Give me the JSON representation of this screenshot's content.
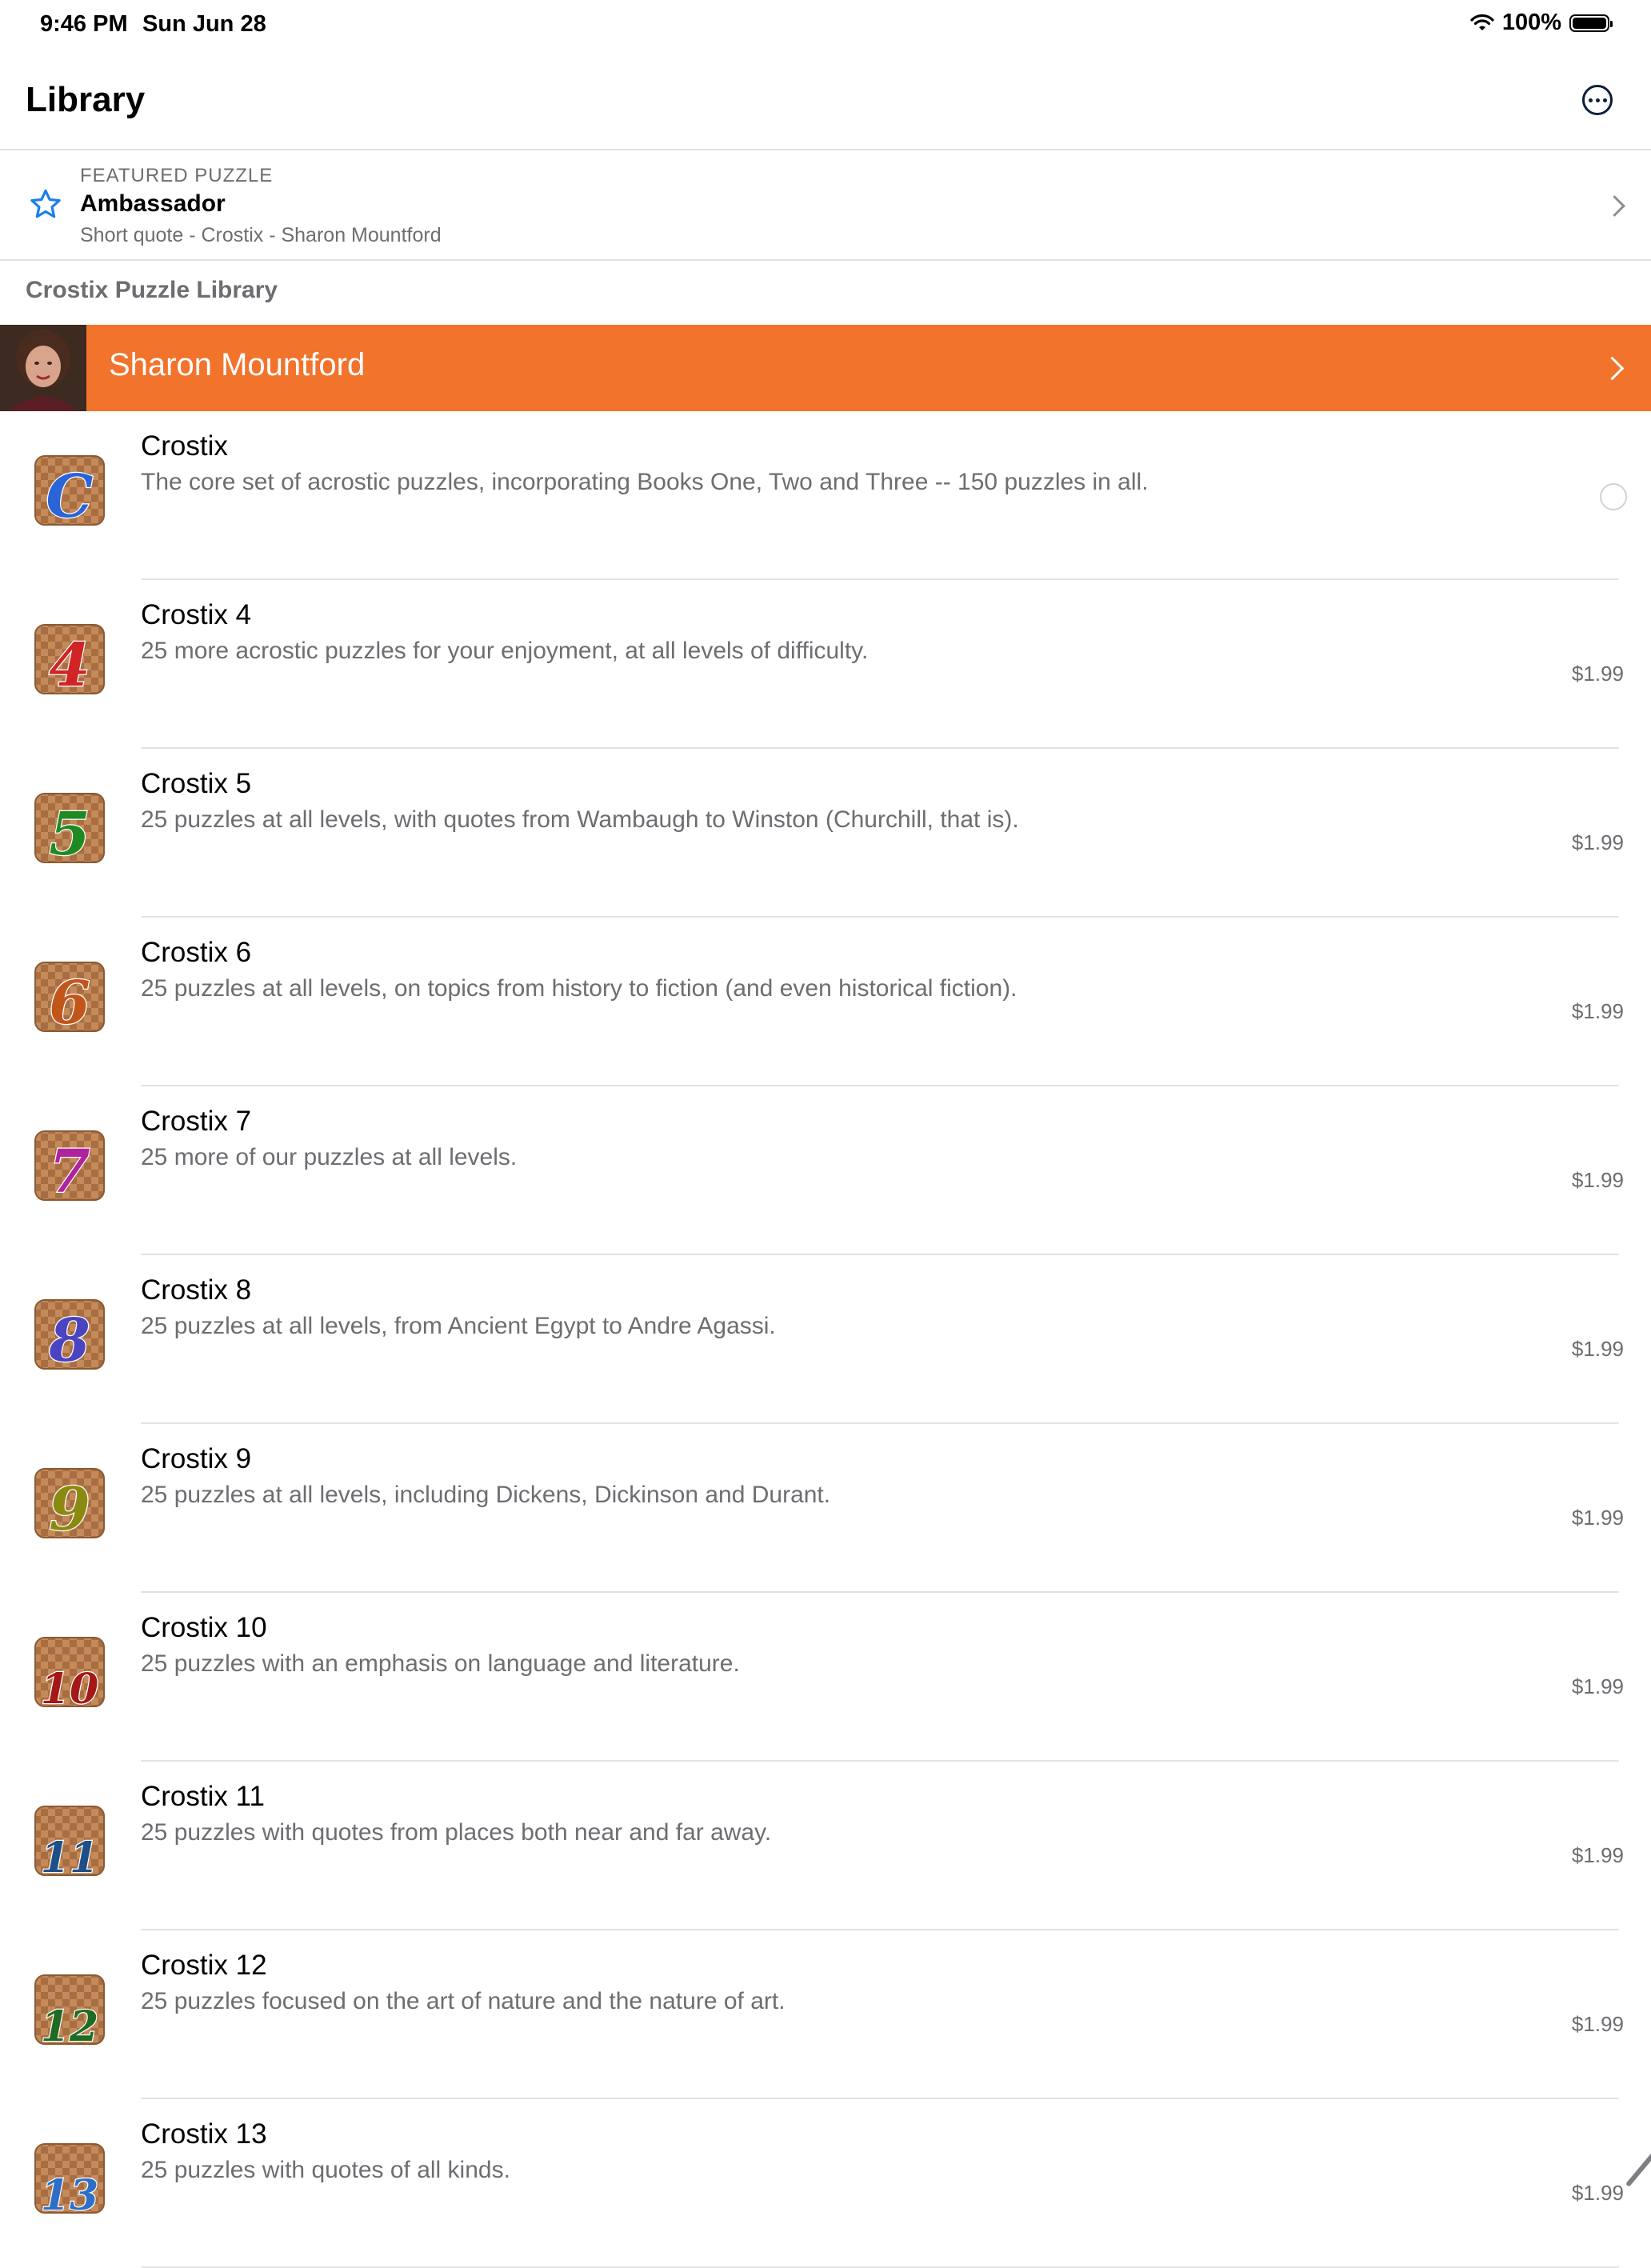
{
  "status_bar": {
    "time": "9:46 PM",
    "date": "Sun Jun 28",
    "battery": "100%",
    "battery_level": 1.0
  },
  "nav": {
    "title": "Library",
    "more_icon": "ellipsis-circle-icon"
  },
  "featured": {
    "label": "FEATURED PUZZLE",
    "title": "Ambassador",
    "subtitle": "Short quote - Crostix - Sharon Mountford",
    "icon": "star-icon"
  },
  "section_header": "Crostix Puzzle Library",
  "author": {
    "name": "Sharon Mountford",
    "color": "#f1732c"
  },
  "items": [
    {
      "title": "Crostix",
      "desc": "The core set of acrostic puzzles, incorporating Books One, Two and Three -- 150 puzzles in all.",
      "price": "",
      "glyph": "C",
      "color": "#2a64d6",
      "owned": true
    },
    {
      "title": "Crostix 4",
      "desc": "25 more acrostic puzzles for your enjoyment, at all levels of difficulty.",
      "price": "$1.99",
      "glyph": "4",
      "color": "#d12424"
    },
    {
      "title": "Crostix 5",
      "desc": "25 puzzles at all levels, with quotes from Wambaugh to Winston (Churchill, that is).",
      "price": "$1.99",
      "glyph": "5",
      "color": "#1f8a22"
    },
    {
      "title": "Crostix 6",
      "desc": "25 puzzles at all levels, on topics from history to fiction (and even historical fiction).",
      "price": "$1.99",
      "glyph": "6",
      "color": "#c2561a"
    },
    {
      "title": "Crostix 7",
      "desc": "25 more of our puzzles at all levels.",
      "price": "$1.99",
      "glyph": "7",
      "color": "#b0229e"
    },
    {
      "title": "Crostix 8",
      "desc": "25 puzzles at all levels, from Ancient Egypt to Andre Agassi.",
      "price": "$1.99",
      "glyph": "8",
      "color": "#4a43c2"
    },
    {
      "title": "Crostix 9",
      "desc": "25 puzzles at all levels, including Dickens, Dickinson and Durant.",
      "price": "$1.99",
      "glyph": "9",
      "color": "#8a8a12"
    },
    {
      "title": "Crostix 10",
      "desc": "25 puzzles with an emphasis on language and literature.",
      "price": "$1.99",
      "glyph": "10",
      "color": "#a51818"
    },
    {
      "title": "Crostix 11",
      "desc": "25 puzzles with quotes from places both near and far away.",
      "price": "$1.99",
      "glyph": "11",
      "color": "#1d4f88"
    },
    {
      "title": "Crostix 12",
      "desc": "25 puzzles focused on the art of nature and the nature of art.",
      "price": "$1.99",
      "glyph": "12",
      "color": "#1f6b24"
    },
    {
      "title": "Crostix 13",
      "desc": "25 puzzles with quotes of all kinds.",
      "price": "$1.99",
      "glyph": "13",
      "color": "#2d6fc7"
    }
  ]
}
